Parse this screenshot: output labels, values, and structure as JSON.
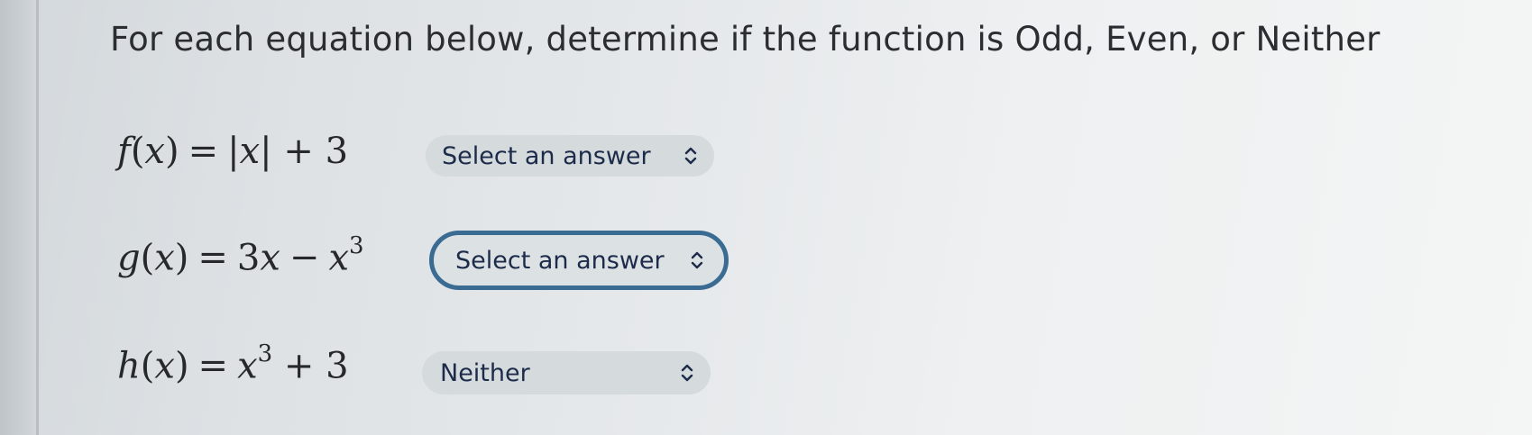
{
  "prompt": "For each equation below, determine if the function is Odd, Even, or Neither",
  "equations": [
    {
      "lhs_fn": "f",
      "lhs_var": "x",
      "rhs": "|x| + 3",
      "rhs_parts": {
        "a": "|",
        "b": "x",
        "c": "|",
        "d": "+ 3"
      },
      "selected": "Select an answer",
      "focused": false
    },
    {
      "lhs_fn": "g",
      "lhs_var": "x",
      "rhs_parts": {
        "a": "3",
        "b": "x",
        "c": "−",
        "d": "x",
        "exp": "3"
      },
      "selected": "Select an answer",
      "focused": true
    },
    {
      "lhs_fn": "h",
      "lhs_var": "x",
      "rhs_parts": {
        "a": "x",
        "exp": "3",
        "d": "+ 3"
      },
      "selected": "Neither",
      "focused": false
    }
  ],
  "colors": {
    "focus_ring": "#3a6b92",
    "select_text": "#1d2b4a",
    "select_bg": "#d5dadd"
  },
  "icons": {
    "dropdown": "chevron-up-down-icon"
  }
}
